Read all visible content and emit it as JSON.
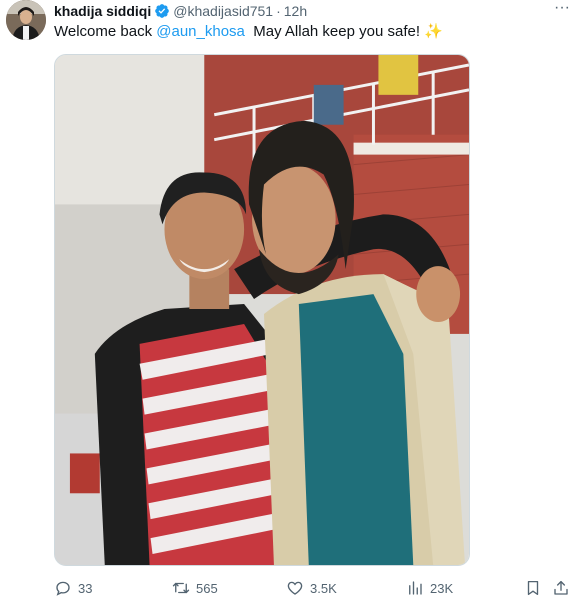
{
  "tweet": {
    "display_name": "khadija siddiqi",
    "handle": "@khadijasid751",
    "separator": "·",
    "time": "12h",
    "text_before": "Welcome back ",
    "mention": "@aun_khosa",
    "text_after": "  May Allah keep you safe! ",
    "emoji": "✨",
    "more_label": "···",
    "verified_icon": "verified-badge-icon",
    "accent_color": "#1d9bf0"
  },
  "actions": {
    "replies": "33",
    "retweets": "565",
    "likes": "3.5K",
    "views": "23K",
    "icons": [
      "reply-icon",
      "retweet-icon",
      "like-icon",
      "views-icon",
      "bookmark-icon",
      "share-icon"
    ]
  },
  "media": {
    "type": "photo",
    "subject": "two-men-photo"
  }
}
